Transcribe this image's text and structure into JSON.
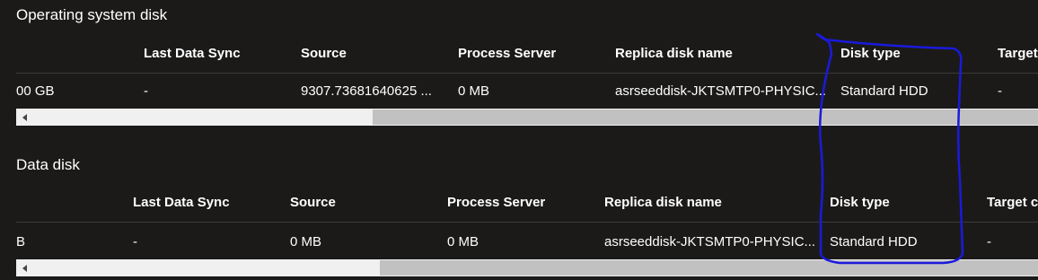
{
  "os_disk": {
    "title": "Operating system disk",
    "columns": [
      "Last Data Sync",
      "Source",
      "Process Server",
      "Replica disk name",
      "Disk type",
      "Target"
    ],
    "row": {
      "size_partial": "00 GB",
      "last_data_sync": "-",
      "source": "9307.73681640625 ...",
      "process_server": "0 MB",
      "replica_disk_name": "asrseeddisk-JKTSMTP0-PHYSIC...",
      "disk_type": "Standard HDD",
      "target": "-"
    }
  },
  "data_disk": {
    "title": "Data disk",
    "columns": [
      "Last Data Sync",
      "Source",
      "Process Server",
      "Replica disk name",
      "Disk type",
      "Target c"
    ],
    "row": {
      "size_partial": "B",
      "last_data_sync": "-",
      "source": "0 MB",
      "process_server": "0 MB",
      "replica_disk_name": "asrseeddisk-JKTSMTP0-PHYSIC...",
      "disk_type": "Standard HDD",
      "target": "-"
    }
  },
  "annotation": {
    "color": "#1a1adb",
    "shape": "hand-drawn outline around Disk type column"
  }
}
